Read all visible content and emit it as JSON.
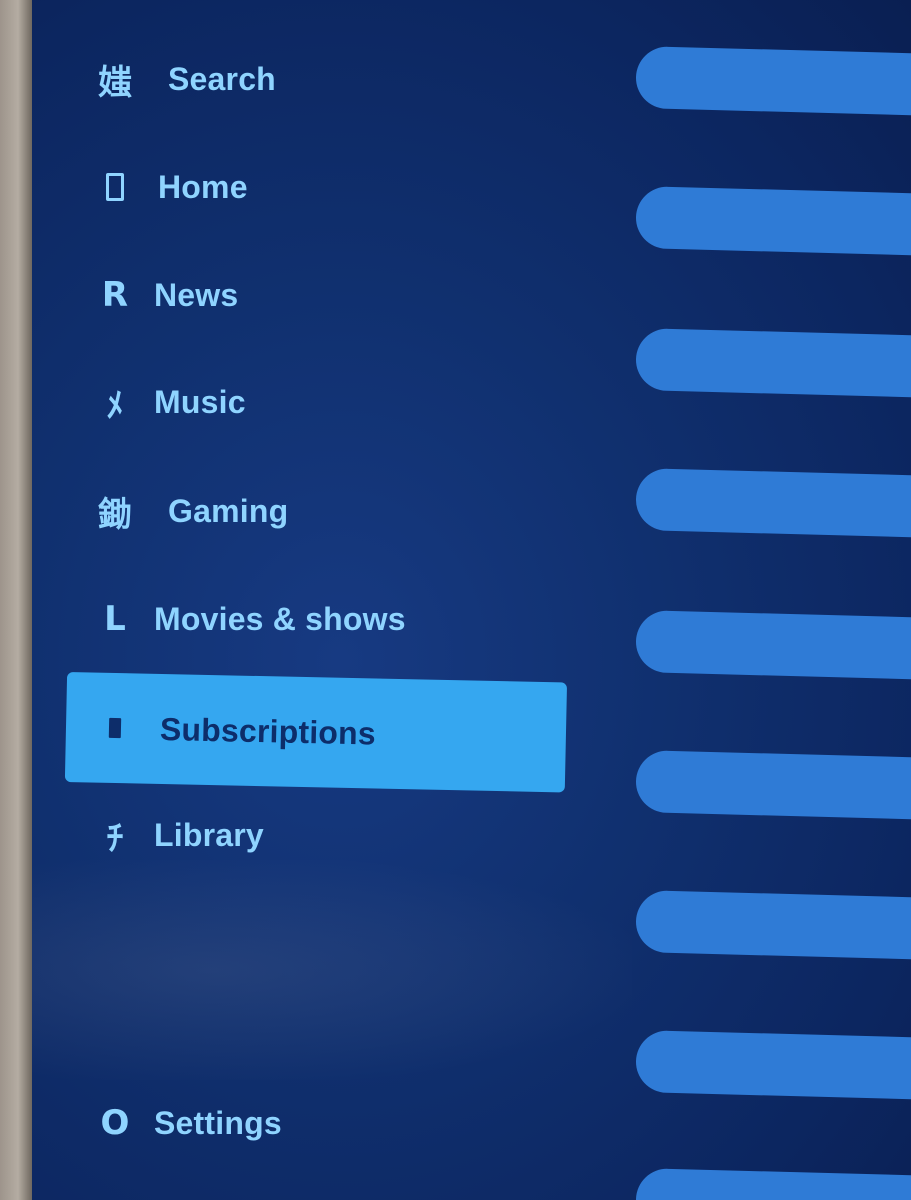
{
  "nav": {
    "items": [
      {
        "label": "Search",
        "icon": "媸"
      },
      {
        "label": "Home",
        "icon": ""
      },
      {
        "label": "News",
        "icon": "R"
      },
      {
        "label": "Music",
        "icon": "ﾒ"
      },
      {
        "label": "Gaming",
        "icon": "鋤"
      },
      {
        "label": "Movies & shows",
        "icon": "L"
      },
      {
        "label": "Subscriptions",
        "icon": ""
      },
      {
        "label": "Library",
        "icon": "ﾁ"
      }
    ],
    "settings": {
      "label": "Settings",
      "icon": "O"
    },
    "selected_index": 6
  },
  "colors": {
    "background": "#0e2a66",
    "text": "#8fd4ff",
    "highlight": "#35a7f0",
    "pill": "#2f7bd6"
  }
}
